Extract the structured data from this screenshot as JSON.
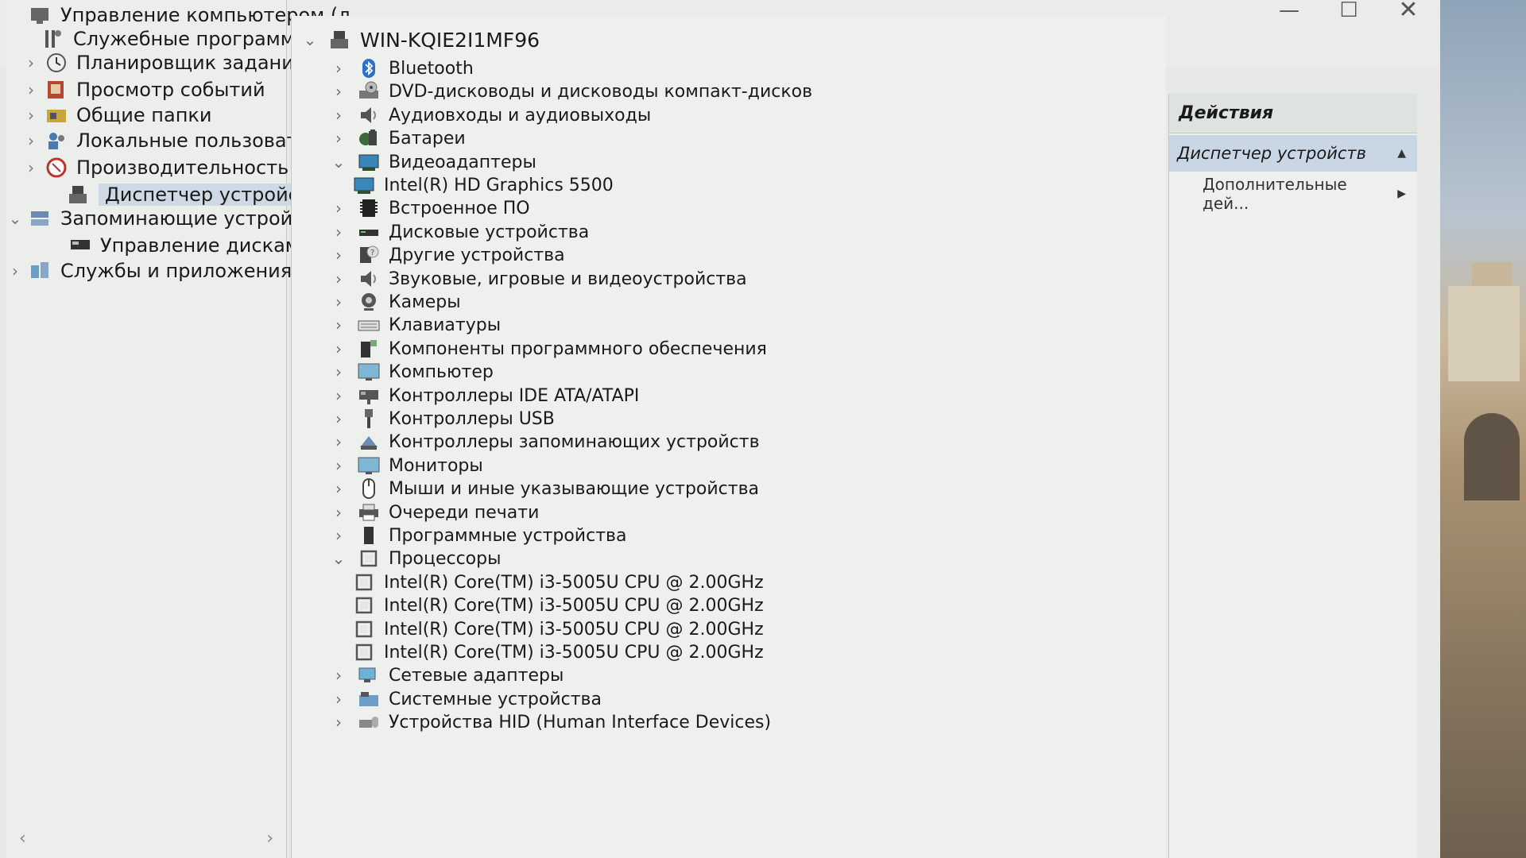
{
  "window": {
    "controls": {
      "minimize": "—",
      "maximize": "☐",
      "close": "✕"
    }
  },
  "nav": {
    "items": [
      {
        "label": "Управление компьютером (л",
        "arrow": "",
        "icon": "computer-management-icon",
        "indent": 0,
        "selected": false
      },
      {
        "label": "Служебные программы",
        "arrow": "",
        "icon": "tools-icon",
        "indent": 1,
        "selected": false
      },
      {
        "label": "Планировщик заданий",
        "arrow": "›",
        "icon": "clock-icon",
        "indent": 2,
        "selected": false
      },
      {
        "label": "Просмотр событий",
        "arrow": "›",
        "icon": "event-viewer-icon",
        "indent": 2,
        "selected": false
      },
      {
        "label": "Общие папки",
        "arrow": "›",
        "icon": "shared-folder-icon",
        "indent": 2,
        "selected": false
      },
      {
        "label": "Локальные пользовате",
        "arrow": "›",
        "icon": "users-icon",
        "indent": 2,
        "selected": false
      },
      {
        "label": "Производительность",
        "arrow": "›",
        "icon": "performance-icon",
        "indent": 2,
        "selected": false
      },
      {
        "label": "Диспетчер устройств",
        "arrow": "",
        "icon": "device-manager-icon",
        "indent": 2,
        "selected": true
      },
      {
        "label": "Запоминающие устройст",
        "arrow": "⌄",
        "icon": "storage-icon",
        "indent": 1,
        "selected": false
      },
      {
        "label": "Управление дисками",
        "arrow": "",
        "icon": "disk-management-icon",
        "indent": 2,
        "selected": false
      },
      {
        "label": "Службы и приложения",
        "arrow": "›",
        "icon": "services-icon",
        "indent": 1,
        "selected": false
      }
    ],
    "scroll_left": "‹",
    "scroll_right": "›"
  },
  "tree": {
    "root": {
      "label": "WIN-KQIE2I1MF96",
      "arrow": "⌄"
    },
    "items": [
      {
        "label": "Bluetooth",
        "arrow": "›",
        "icon": "bluetooth-icon",
        "level": 1
      },
      {
        "label": "DVD-дисководы и дисководы компакт-дисков",
        "arrow": "›",
        "icon": "dvd-drive-icon",
        "level": 1
      },
      {
        "label": "Аудиовходы и аудиовыходы",
        "arrow": "›",
        "icon": "speaker-icon",
        "level": 1
      },
      {
        "label": "Батареи",
        "arrow": "›",
        "icon": "battery-icon",
        "level": 1
      },
      {
        "label": "Видеоадаптеры",
        "arrow": "⌄",
        "icon": "display-adapter-icon",
        "level": 1
      },
      {
        "label": "Intel(R) HD Graphics 5500",
        "arrow": "",
        "icon": "display-adapter-icon",
        "level": 2
      },
      {
        "label": "Встроенное ПО",
        "arrow": "›",
        "icon": "firmware-icon",
        "level": 1
      },
      {
        "label": "Дисковые устройства",
        "arrow": "›",
        "icon": "disk-drive-icon",
        "level": 1
      },
      {
        "label": "Другие устройства",
        "arrow": "›",
        "icon": "unknown-device-icon",
        "level": 1
      },
      {
        "label": "Звуковые, игровые и видеоустройства",
        "arrow": "›",
        "icon": "sound-icon",
        "level": 1
      },
      {
        "label": "Камеры",
        "arrow": "›",
        "icon": "camera-icon",
        "level": 1
      },
      {
        "label": "Клавиатуры",
        "arrow": "›",
        "icon": "keyboard-icon",
        "level": 1
      },
      {
        "label": "Компоненты программного обеспечения",
        "arrow": "›",
        "icon": "software-component-icon",
        "level": 1
      },
      {
        "label": "Компьютер",
        "arrow": "›",
        "icon": "computer-icon",
        "level": 1
      },
      {
        "label": "Контроллеры IDE ATA/ATAPI",
        "arrow": "›",
        "icon": "ide-controller-icon",
        "level": 1
      },
      {
        "label": "Контроллеры USB",
        "arrow": "›",
        "icon": "usb-icon",
        "level": 1
      },
      {
        "label": "Контроллеры запоминающих устройств",
        "arrow": "›",
        "icon": "storage-controller-icon",
        "level": 1
      },
      {
        "label": "Мониторы",
        "arrow": "›",
        "icon": "monitor-icon",
        "level": 1
      },
      {
        "label": "Мыши и иные указывающие устройства",
        "arrow": "›",
        "icon": "mouse-icon",
        "level": 1
      },
      {
        "label": "Очереди печати",
        "arrow": "›",
        "icon": "printer-icon",
        "level": 1
      },
      {
        "label": "Программные устройства",
        "arrow": "›",
        "icon": "software-device-icon",
        "level": 1
      },
      {
        "label": "Процессоры",
        "arrow": "⌄",
        "icon": "processor-icon",
        "level": 1
      },
      {
        "label": "Intel(R) Core(TM) i3-5005U CPU @ 2.00GHz",
        "arrow": "",
        "icon": "processor-icon",
        "level": 2
      },
      {
        "label": "Intel(R) Core(TM) i3-5005U CPU @ 2.00GHz",
        "arrow": "",
        "icon": "processor-icon",
        "level": 2
      },
      {
        "label": "Intel(R) Core(TM) i3-5005U CPU @ 2.00GHz",
        "arrow": "",
        "icon": "processor-icon",
        "level": 2
      },
      {
        "label": "Intel(R) Core(TM) i3-5005U CPU @ 2.00GHz",
        "arrow": "",
        "icon": "processor-icon",
        "level": 2
      },
      {
        "label": "Сетевые адаптеры",
        "arrow": "›",
        "icon": "network-adapter-icon",
        "level": 1
      },
      {
        "label": "Системные устройства",
        "arrow": "›",
        "icon": "system-device-icon",
        "level": 1
      },
      {
        "label": "Устройства HID (Human Interface Devices)",
        "arrow": "›",
        "icon": "hid-icon",
        "level": 1
      }
    ]
  },
  "actions": {
    "header": "Действия",
    "section": {
      "label": "Диспетчер устройств",
      "arrow": "▲"
    },
    "items": [
      {
        "label": "Дополнительные дей...",
        "arrow": "▶"
      }
    ]
  },
  "colors": {
    "selection": "#cfd9e6",
    "actions_section": "#c9d6e4",
    "pane_bg": "#eef0ee"
  }
}
